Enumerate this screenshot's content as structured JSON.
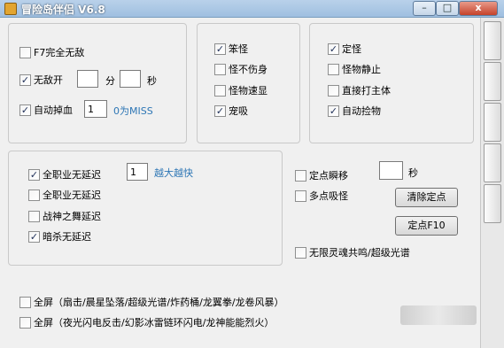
{
  "titlebar": {
    "title": "冒险岛伴侣  V6.8",
    "min": "–",
    "max": "□",
    "close": "x"
  },
  "group1": {
    "f7_invincible": {
      "label": "F7完全无敌",
      "checked": false
    },
    "invincible_on": {
      "label": "无敌开",
      "checked": true,
      "minutes": "",
      "min_label": "分",
      "seconds": "",
      "sec_label": "秒"
    },
    "auto_drop_hp": {
      "label": "自动掉血",
      "checked": true,
      "value": "1",
      "hint": "0为MISS"
    }
  },
  "group2": {
    "items": [
      {
        "label": "笨怪",
        "checked": true
      },
      {
        "label": "怪不伤身",
        "checked": false
      },
      {
        "label": "怪物速显",
        "checked": false
      },
      {
        "label": "宠吸",
        "checked": true
      }
    ]
  },
  "group3": {
    "items": [
      {
        "label": "定怪",
        "checked": true
      },
      {
        "label": "怪物静止",
        "checked": false
      },
      {
        "label": "直接打主体",
        "checked": false
      },
      {
        "label": "自动捡物",
        "checked": true
      }
    ]
  },
  "group4": {
    "items": [
      {
        "label": "全职业无延迟",
        "checked": true
      },
      {
        "label": "全职业无延迟",
        "checked": false
      },
      {
        "label": "战神之舞延迟",
        "checked": false
      },
      {
        "label": "暗杀无延迟",
        "checked": true
      }
    ],
    "speed_value": "1",
    "speed_hint": "越大越快"
  },
  "right_panel": {
    "teleport": {
      "label": "定点瞬移",
      "checked": false,
      "seconds": "",
      "sec_label": "秒"
    },
    "multi_suck": {
      "label": "多点吸怪",
      "checked": false
    },
    "clear_point_button": "清除定点",
    "set_point_button": "定点F10",
    "soul_resonance": {
      "label": "无限灵魂共鸣/超级光谱",
      "checked": false
    }
  },
  "bottom": {
    "fullscreen1": {
      "label": "全屏（扇击/晨星坠落/超级光谱/炸药桶/龙翼拳/龙卷风暴）",
      "checked": false
    },
    "fullscreen2": {
      "label": "全屏（夜光闪电反击/幻影冰雷链环闪电/龙神能能烈火）",
      "checked": false
    }
  },
  "check_mark": "✓"
}
